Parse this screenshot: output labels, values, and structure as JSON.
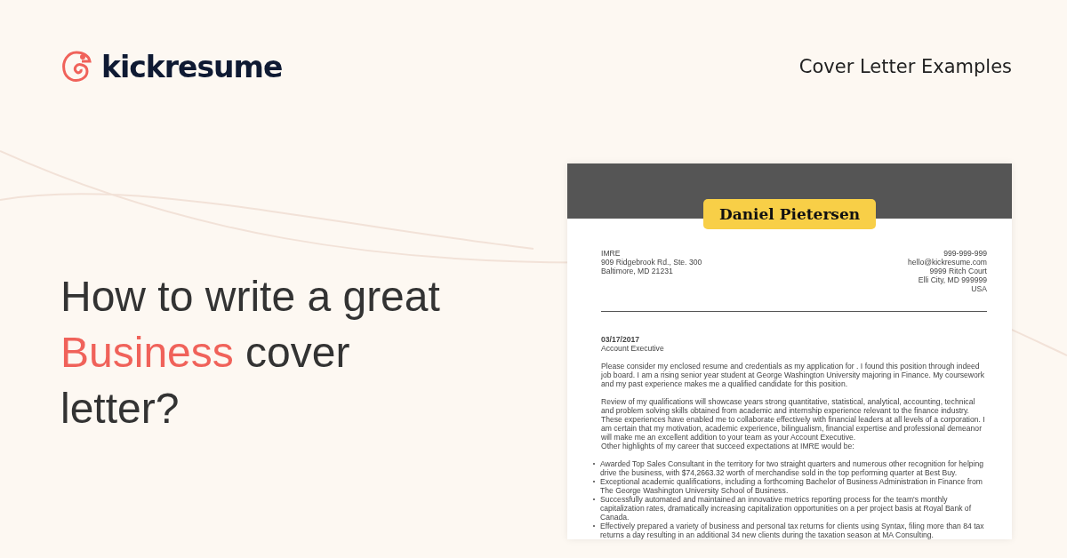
{
  "header": {
    "logo": "kickresume",
    "nav_link": "Cover Letter Examples"
  },
  "hero": {
    "title_parts": [
      {
        "text": "How to write a great ",
        "highlight": false
      },
      {
        "text": "Business",
        "highlight": true
      },
      {
        "text": " cover letter?",
        "highlight": false
      }
    ]
  },
  "letter": {
    "name": "Daniel Pietersen",
    "recipient": [
      "IMRE",
      "909 Ridgebrook Rd., Ste. 300",
      "Baltimore, MD 21231"
    ],
    "sender": [
      "999-999-999",
      "hello@kickresume.com",
      "9999 Ritch Court",
      "Elli City, MD 999999",
      "USA"
    ],
    "date": "03/17/2017",
    "position": "Account Executive",
    "paragraphs": [
      "Please consider my enclosed resume and credentials as my application for . I found this position through indeed job board. I am a rising senior year student at George Washington University majoring in Finance. My coursework and my past experience makes me a qualified candidate for this position.",
      "Review of my qualifications will showcase years strong quantitative, statistical, analytical, accounting, technical and problem solving skills obtained from academic and internship experience relevant to the finance industry. These experiences have enabled me to collaborate effectively with financial leaders at all levels of a corporation. I am certain that my motivation, academic experience, bilingualism, financial expertise and professional demeanor will make me an excellent addition to your team as your Account Executive.\nOther highlights of my career that succeed expectations at IMRE would be:"
    ],
    "bullets": [
      "Awarded Top Sales Consultant in the territory for two straight quarters and numerous other recognition for helping drive the business, with $74,2663.32 worth of merchandise sold in the top performing quarter at Best Buy.",
      "Exceptional academic qualifications, including a forthcoming Bachelor of Business Administration in Finance from The George Washington University School of Business.",
      "Successfully automated and maintained an innovative metrics reporting process for the team's monthly capitalization rates, dramatically increasing capitalization opportunities on a per project basis at Royal Bank of Canada.",
      "Effectively prepared a variety of business and personal tax returns for clients using Syntax, filing more than 84 tax returns a day resulting in an additional 34 new clients during the taxation season at MA Consulting."
    ]
  }
}
